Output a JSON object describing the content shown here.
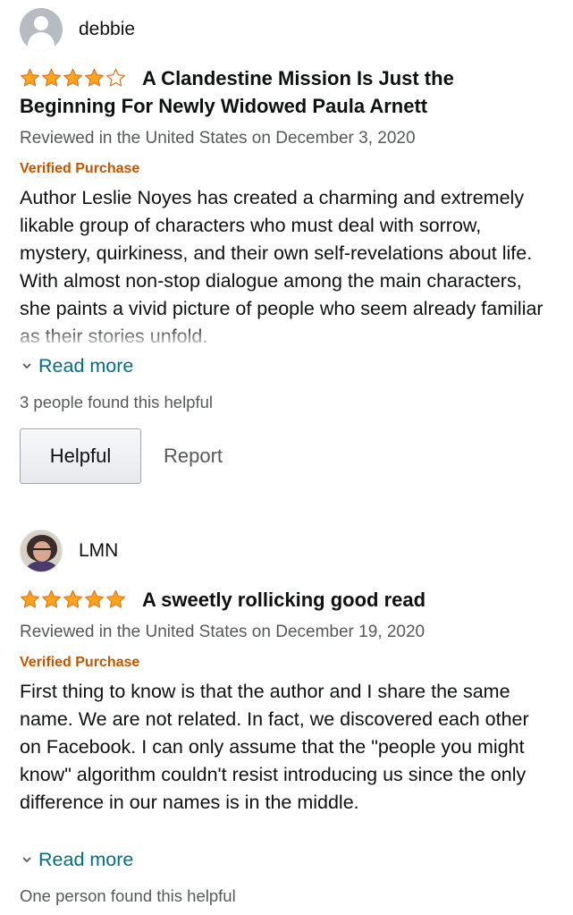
{
  "reviews": [
    {
      "reviewer": "debbie",
      "rating": 4,
      "title": "A Clandestine Mission Is Just the Beginning For Newly Widowed Paula Arnett",
      "meta": "Reviewed in the United States on December 3, 2020",
      "verified": "Verified Purchase",
      "body": "Author Leslie Noyes has created a charming and extremely likable group of characters who must deal with sorrow, mystery, quirkiness, and their own self-revelations about life. With almost non-stop dialogue among the main characters, she paints a vivid picture of people who seem already familiar as their stories unfold.",
      "read_more": "Read more",
      "helpful_count": "3 people found this helpful",
      "helpful_label": "Helpful",
      "report_label": "Report"
    },
    {
      "reviewer": "LMN",
      "rating": 5,
      "title": "A sweetly rollicking good read",
      "meta": "Reviewed in the United States on December 19, 2020",
      "verified": "Verified Purchase",
      "body": "First thing to know is that the author and I share the same name. We are not related. In fact, we discovered each other on Facebook. I can only assume that the \"people you might know\" algorithm couldn't resist introducing us since the only difference in our names is in the middle.",
      "read_more": "Read more",
      "helpful_count": "One person found this helpful"
    }
  ],
  "colors": {
    "star": "#ffa41c",
    "star_outline": "#de7921",
    "link": "#007185",
    "verified": "#c45500",
    "meta": "#565959"
  }
}
